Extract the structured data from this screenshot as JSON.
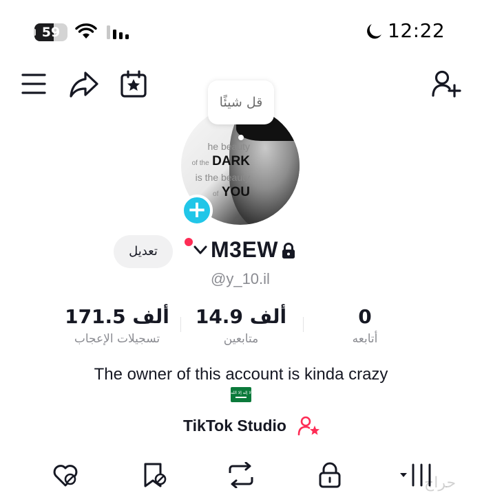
{
  "status_bar": {
    "battery_level": "59",
    "battery_fraction": 0.59,
    "time": "12:22",
    "icons": [
      "wifi-icon",
      "cellular-signal-icon",
      "moon-icon"
    ]
  },
  "nav": {
    "icons": [
      "menu-icon",
      "share-icon",
      "calendar-star-icon",
      "add-friend-icon"
    ]
  },
  "profile": {
    "avatar_text": [
      "he beauty",
      "of the",
      "DARK",
      "is the beauty",
      "of",
      "YOU"
    ],
    "note_placeholder": "قل شيئًا",
    "edit_label": "تعديل",
    "username": "M3EW",
    "handle": "@y_10.il",
    "bio": "The owner of this account is kinda crazy",
    "flag_text": "لا إله إلا الله",
    "studio_label": "TikTok Studio"
  },
  "stats": {
    "likes_value": "171.5 ألف",
    "likes_label": "تسجيلات الإعجاب",
    "followers_value": "14.9 ألف",
    "followers_label": "متابعين",
    "following_value": "0",
    "following_label": "أتابعه"
  },
  "tabs": [
    "liked-icon",
    "favorites-icon",
    "reposts-icon",
    "private-icon",
    "videos-grid-icon"
  ],
  "colors": {
    "accent_cyan": "#21c6e8",
    "accent_red": "#fe2c55",
    "text_primary": "#161823",
    "text_secondary": "#8a8b91"
  }
}
